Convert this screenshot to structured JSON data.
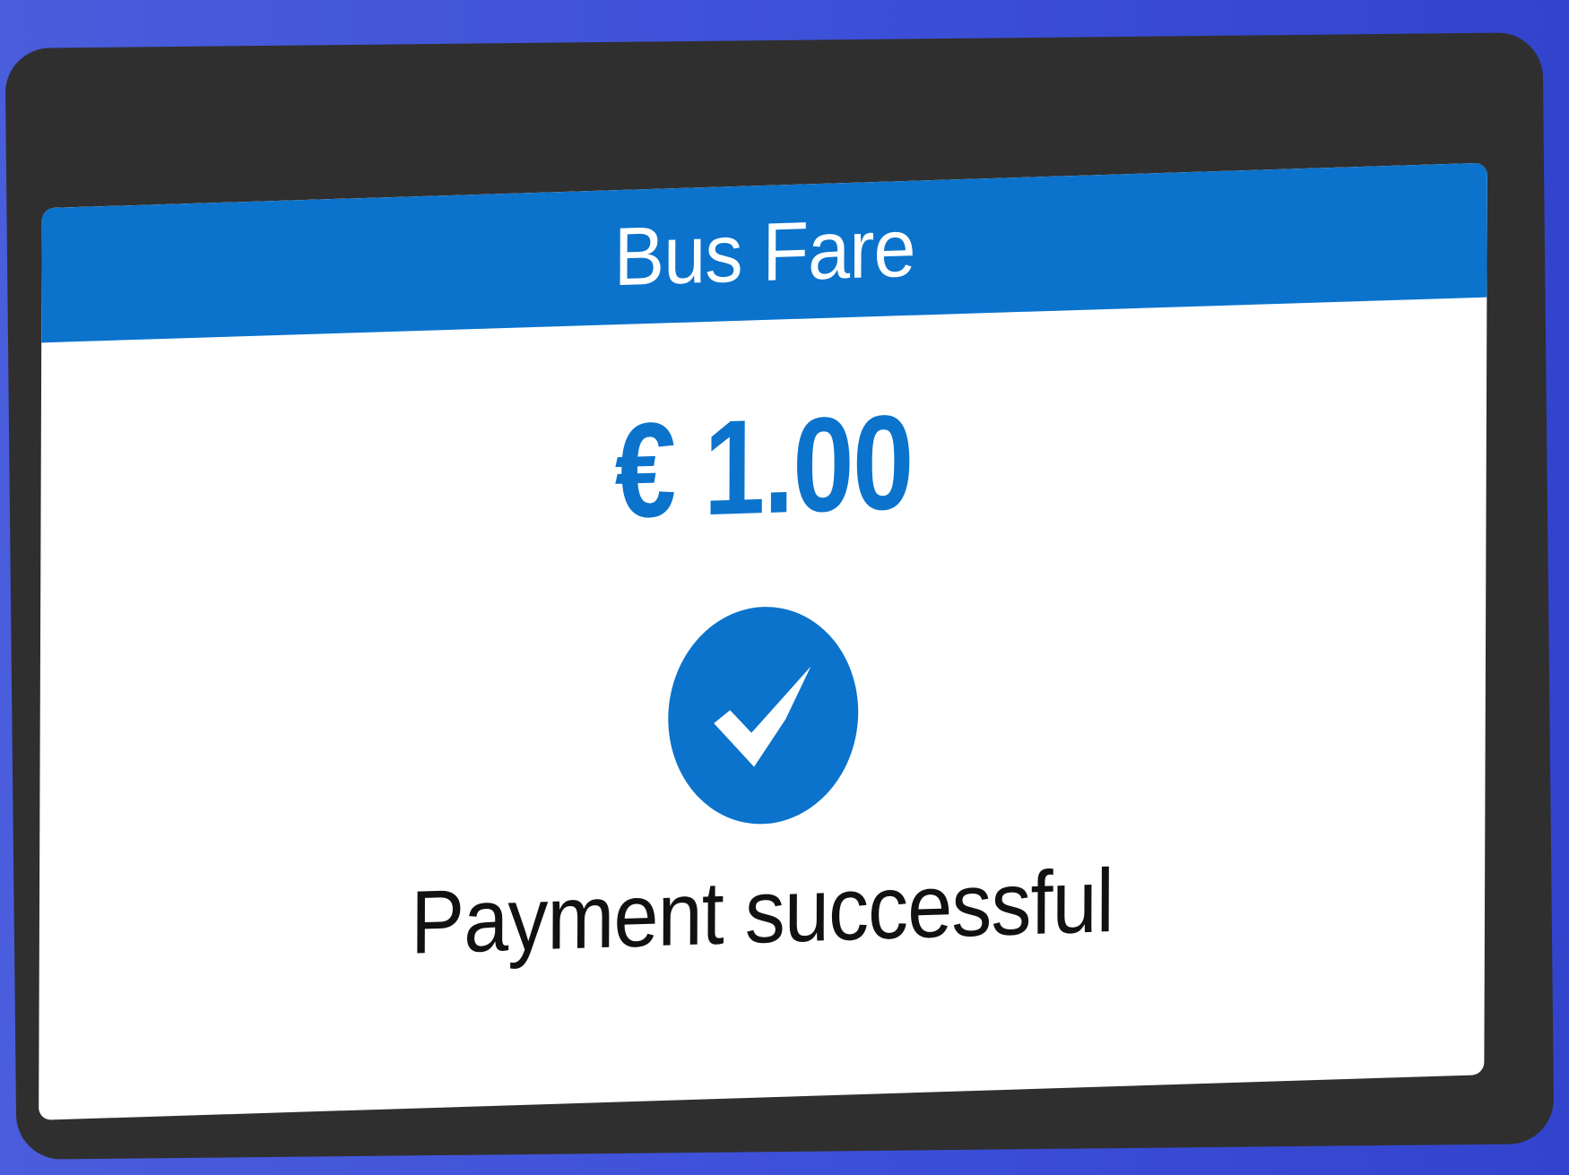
{
  "header": {
    "title": "Bus Fare"
  },
  "payment": {
    "amount": "€ 1.00",
    "status_text": "Payment successful",
    "status_icon": "check-circle-icon"
  },
  "colors": {
    "accent": "#0b73cc",
    "background": "#4a5ddc",
    "device_frame": "#2f2f2f",
    "screen": "#ffffff",
    "text": "#111111"
  }
}
